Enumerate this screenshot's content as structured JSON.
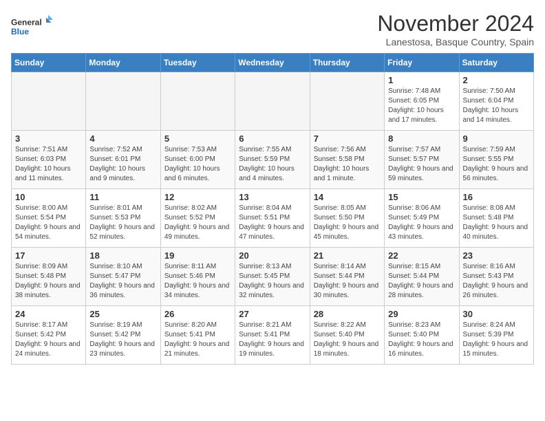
{
  "logo": {
    "line1": "General",
    "line2": "Blue"
  },
  "header": {
    "title": "November 2024",
    "location": "Lanestosa, Basque Country, Spain"
  },
  "weekdays": [
    "Sunday",
    "Monday",
    "Tuesday",
    "Wednesday",
    "Thursday",
    "Friday",
    "Saturday"
  ],
  "weeks": [
    [
      {
        "day": "",
        "empty": true
      },
      {
        "day": "",
        "empty": true
      },
      {
        "day": "",
        "empty": true
      },
      {
        "day": "",
        "empty": true
      },
      {
        "day": "",
        "empty": true
      },
      {
        "day": "1",
        "sunrise": "Sunrise: 7:48 AM",
        "sunset": "Sunset: 6:05 PM",
        "daylight": "Daylight: 10 hours and 17 minutes."
      },
      {
        "day": "2",
        "sunrise": "Sunrise: 7:50 AM",
        "sunset": "Sunset: 6:04 PM",
        "daylight": "Daylight: 10 hours and 14 minutes."
      }
    ],
    [
      {
        "day": "3",
        "sunrise": "Sunrise: 7:51 AM",
        "sunset": "Sunset: 6:03 PM",
        "daylight": "Daylight: 10 hours and 11 minutes."
      },
      {
        "day": "4",
        "sunrise": "Sunrise: 7:52 AM",
        "sunset": "Sunset: 6:01 PM",
        "daylight": "Daylight: 10 hours and 9 minutes."
      },
      {
        "day": "5",
        "sunrise": "Sunrise: 7:53 AM",
        "sunset": "Sunset: 6:00 PM",
        "daylight": "Daylight: 10 hours and 6 minutes."
      },
      {
        "day": "6",
        "sunrise": "Sunrise: 7:55 AM",
        "sunset": "Sunset: 5:59 PM",
        "daylight": "Daylight: 10 hours and 4 minutes."
      },
      {
        "day": "7",
        "sunrise": "Sunrise: 7:56 AM",
        "sunset": "Sunset: 5:58 PM",
        "daylight": "Daylight: 10 hours and 1 minute."
      },
      {
        "day": "8",
        "sunrise": "Sunrise: 7:57 AM",
        "sunset": "Sunset: 5:57 PM",
        "daylight": "Daylight: 9 hours and 59 minutes."
      },
      {
        "day": "9",
        "sunrise": "Sunrise: 7:59 AM",
        "sunset": "Sunset: 5:55 PM",
        "daylight": "Daylight: 9 hours and 56 minutes."
      }
    ],
    [
      {
        "day": "10",
        "sunrise": "Sunrise: 8:00 AM",
        "sunset": "Sunset: 5:54 PM",
        "daylight": "Daylight: 9 hours and 54 minutes."
      },
      {
        "day": "11",
        "sunrise": "Sunrise: 8:01 AM",
        "sunset": "Sunset: 5:53 PM",
        "daylight": "Daylight: 9 hours and 52 minutes."
      },
      {
        "day": "12",
        "sunrise": "Sunrise: 8:02 AM",
        "sunset": "Sunset: 5:52 PM",
        "daylight": "Daylight: 9 hours and 49 minutes."
      },
      {
        "day": "13",
        "sunrise": "Sunrise: 8:04 AM",
        "sunset": "Sunset: 5:51 PM",
        "daylight": "Daylight: 9 hours and 47 minutes."
      },
      {
        "day": "14",
        "sunrise": "Sunrise: 8:05 AM",
        "sunset": "Sunset: 5:50 PM",
        "daylight": "Daylight: 9 hours and 45 minutes."
      },
      {
        "day": "15",
        "sunrise": "Sunrise: 8:06 AM",
        "sunset": "Sunset: 5:49 PM",
        "daylight": "Daylight: 9 hours and 43 minutes."
      },
      {
        "day": "16",
        "sunrise": "Sunrise: 8:08 AM",
        "sunset": "Sunset: 5:48 PM",
        "daylight": "Daylight: 9 hours and 40 minutes."
      }
    ],
    [
      {
        "day": "17",
        "sunrise": "Sunrise: 8:09 AM",
        "sunset": "Sunset: 5:48 PM",
        "daylight": "Daylight: 9 hours and 38 minutes."
      },
      {
        "day": "18",
        "sunrise": "Sunrise: 8:10 AM",
        "sunset": "Sunset: 5:47 PM",
        "daylight": "Daylight: 9 hours and 36 minutes."
      },
      {
        "day": "19",
        "sunrise": "Sunrise: 8:11 AM",
        "sunset": "Sunset: 5:46 PM",
        "daylight": "Daylight: 9 hours and 34 minutes."
      },
      {
        "day": "20",
        "sunrise": "Sunrise: 8:13 AM",
        "sunset": "Sunset: 5:45 PM",
        "daylight": "Daylight: 9 hours and 32 minutes."
      },
      {
        "day": "21",
        "sunrise": "Sunrise: 8:14 AM",
        "sunset": "Sunset: 5:44 PM",
        "daylight": "Daylight: 9 hours and 30 minutes."
      },
      {
        "day": "22",
        "sunrise": "Sunrise: 8:15 AM",
        "sunset": "Sunset: 5:44 PM",
        "daylight": "Daylight: 9 hours and 28 minutes."
      },
      {
        "day": "23",
        "sunrise": "Sunrise: 8:16 AM",
        "sunset": "Sunset: 5:43 PM",
        "daylight": "Daylight: 9 hours and 26 minutes."
      }
    ],
    [
      {
        "day": "24",
        "sunrise": "Sunrise: 8:17 AM",
        "sunset": "Sunset: 5:42 PM",
        "daylight": "Daylight: 9 hours and 24 minutes."
      },
      {
        "day": "25",
        "sunrise": "Sunrise: 8:19 AM",
        "sunset": "Sunset: 5:42 PM",
        "daylight": "Daylight: 9 hours and 23 minutes."
      },
      {
        "day": "26",
        "sunrise": "Sunrise: 8:20 AM",
        "sunset": "Sunset: 5:41 PM",
        "daylight": "Daylight: 9 hours and 21 minutes."
      },
      {
        "day": "27",
        "sunrise": "Sunrise: 8:21 AM",
        "sunset": "Sunset: 5:41 PM",
        "daylight": "Daylight: 9 hours and 19 minutes."
      },
      {
        "day": "28",
        "sunrise": "Sunrise: 8:22 AM",
        "sunset": "Sunset: 5:40 PM",
        "daylight": "Daylight: 9 hours and 18 minutes."
      },
      {
        "day": "29",
        "sunrise": "Sunrise: 8:23 AM",
        "sunset": "Sunset: 5:40 PM",
        "daylight": "Daylight: 9 hours and 16 minutes."
      },
      {
        "day": "30",
        "sunrise": "Sunrise: 8:24 AM",
        "sunset": "Sunset: 5:39 PM",
        "daylight": "Daylight: 9 hours and 15 minutes."
      }
    ]
  ]
}
